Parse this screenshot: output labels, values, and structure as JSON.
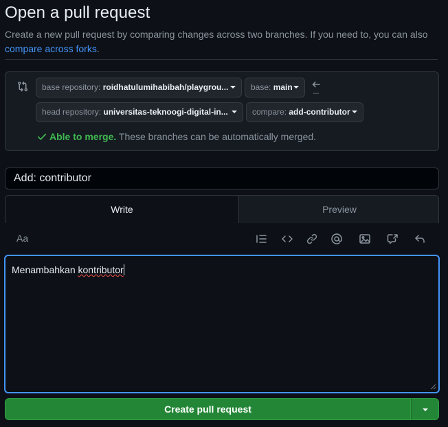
{
  "header": {
    "title": "Open a pull request",
    "subtitle": "Create a new pull request by comparing changes across two branches. If you need to, you can also ",
    "subtitle_link": "compare across forks",
    "subtitle_end": "."
  },
  "compare": {
    "base_repo_label": "base repository: ",
    "base_repo_value": "roidhatulumihabibah/playgrou...",
    "base_label": "base: ",
    "base_value": "main",
    "head_repo_label": "head repository: ",
    "head_repo_value": "universitas-teknoogi-digital-in...",
    "compare_label": "compare: ",
    "compare_value": "add-contributor",
    "merge_ok": "Able to merge.",
    "merge_msg": " These branches can be automatically merged."
  },
  "form": {
    "title_value": "Add: contributor",
    "tab_write": "Write",
    "tab_preview": "Preview",
    "toolbar_text_style": "Aa",
    "body_prefix": "Menambahkan ",
    "body_misspelled": "kontributor",
    "submit_label": "Create pull request"
  },
  "colors": {
    "accent": "#4493f8",
    "success": "#3fb950",
    "button_green": "#238636",
    "background": "#0d1117"
  }
}
